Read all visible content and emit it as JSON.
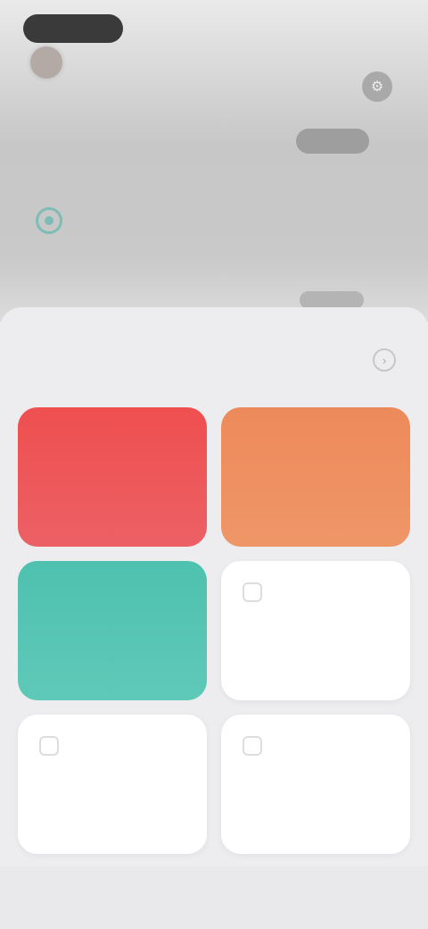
{
  "status": {
    "time": "",
    "right": ""
  },
  "user": {
    "name": ""
  },
  "header": {
    "subtitle": "",
    "action_label": "",
    "feature_label": "",
    "link_label": ""
  },
  "section": {
    "title": ""
  },
  "cards": [
    {
      "label": "",
      "color": "#ec5257"
    },
    {
      "label": "",
      "color": "#ee8f60"
    },
    {
      "label": "",
      "color": "#55c4b2"
    },
    {
      "label": "",
      "color": "#ffffff"
    },
    {
      "label": "",
      "color": "#ffffff"
    },
    {
      "label": "",
      "color": "#ffffff"
    }
  ],
  "icons": {
    "header_action": "settings-icon",
    "feature": "target-icon",
    "section_more": "chevron-right-icon",
    "card": "square-icon"
  }
}
